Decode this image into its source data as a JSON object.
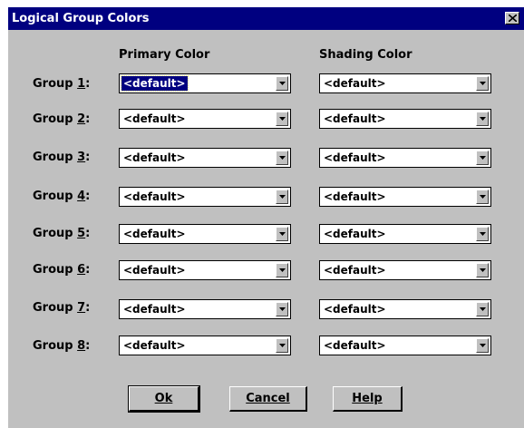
{
  "dialog": {
    "title": "Logical Group Colors"
  },
  "columns": {
    "primary": "Primary Color",
    "shading": "Shading Color"
  },
  "groups": [
    {
      "label": "Group ",
      "num": "1",
      "colon": ":",
      "primary": "<default>",
      "shading": "<default>"
    },
    {
      "label": "Group ",
      "num": "2",
      "colon": ":",
      "primary": "<default>",
      "shading": "<default>"
    },
    {
      "label": "Group ",
      "num": "3",
      "colon": ":",
      "primary": "<default>",
      "shading": "<default>"
    },
    {
      "label": "Group ",
      "num": "4",
      "colon": ":",
      "primary": "<default>",
      "shading": "<default>"
    },
    {
      "label": "Group ",
      "num": "5",
      "colon": ":",
      "primary": "<default>",
      "shading": "<default>"
    },
    {
      "label": "Group ",
      "num": "6",
      "colon": ":",
      "primary": "<default>",
      "shading": "<default>"
    },
    {
      "label": "Group ",
      "num": "7",
      "colon": ":",
      "primary": "<default>",
      "shading": "<default>"
    },
    {
      "label": "Group ",
      "num": "8",
      "colon": ":",
      "primary": "<default>",
      "shading": "<default>"
    }
  ],
  "buttons": {
    "ok": "Ok",
    "cancel": "Cancel",
    "help": "Help"
  },
  "colors": {
    "titlebar": "#000080",
    "face": "#c0c0c0",
    "selection": "#000080"
  },
  "icons": {
    "close": "close-icon",
    "dropdown": "chevron-down-icon"
  }
}
